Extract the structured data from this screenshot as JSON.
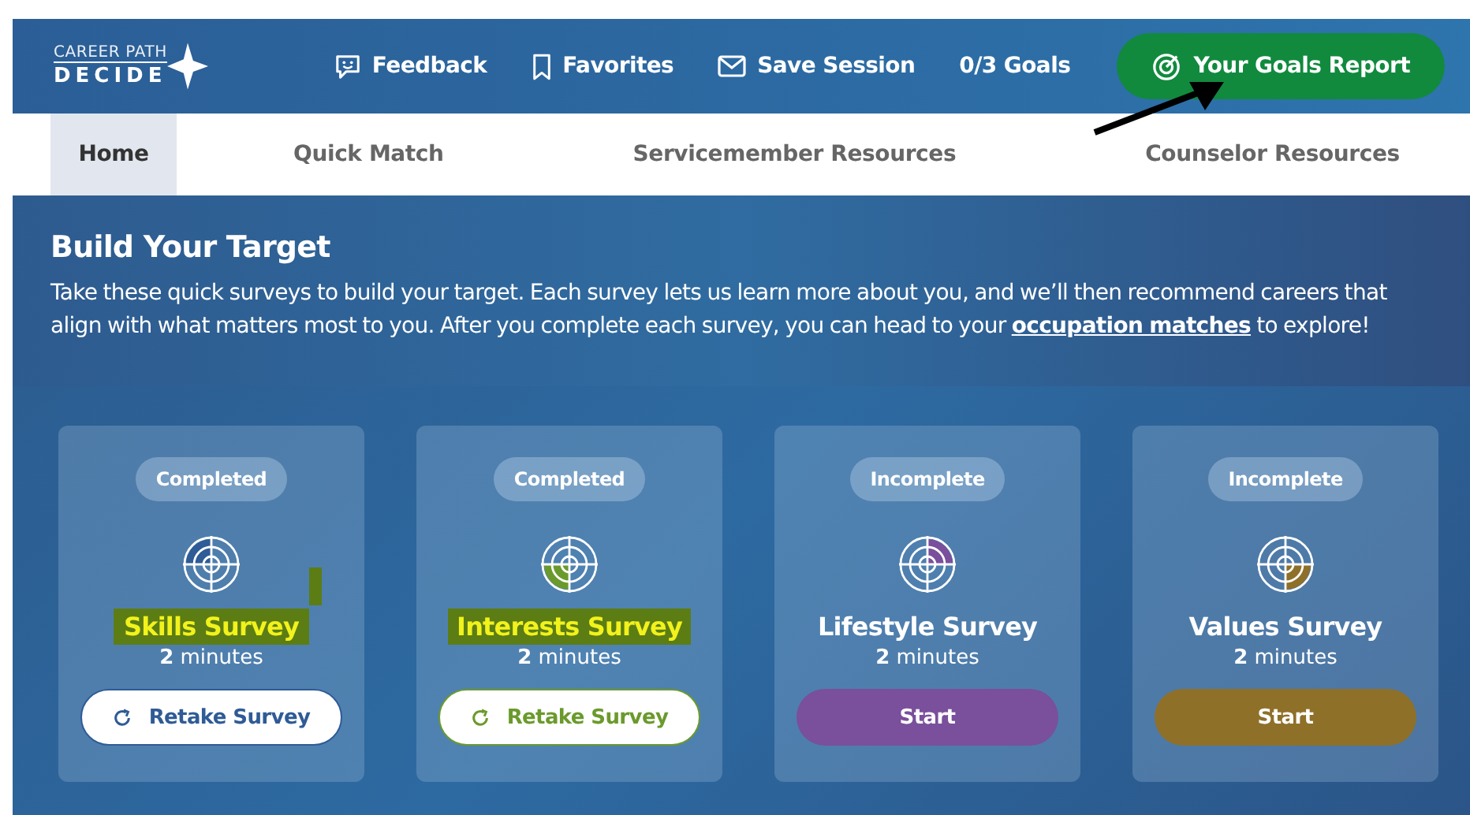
{
  "header": {
    "logo": {
      "top": "CAREER PATH",
      "bottom": "DECIDE"
    },
    "links": [
      {
        "kind": "feedback",
        "label": "Feedback"
      },
      {
        "kind": "favorites",
        "label": "Favorites"
      },
      {
        "kind": "save",
        "label": "Save Session"
      },
      {
        "kind": "goals",
        "label": "0/3 Goals"
      }
    ],
    "report_button": "Your Goals Report"
  },
  "tabs": [
    {
      "label": "Home",
      "selected": true
    },
    {
      "label": "Quick Match",
      "selected": false
    },
    {
      "label": "Servicemember Resources",
      "selected": false
    },
    {
      "label": "Counselor Resources",
      "selected": false
    }
  ],
  "intro": {
    "title": "Build Your Target",
    "text": "Take these quick surveys to build your target. Each survey lets us learn more about you, and we’ll then recommend careers that align with what matters most to you. After you complete each survey, you can head to your",
    "link": "occupation matches",
    "tail": "to explore!"
  },
  "cards": [
    {
      "kind": "completed",
      "status": "Completed",
      "fill_top": true,
      "fill_left": true,
      "color": "#2f5b96",
      "title": "Skills Survey",
      "highlighted": true,
      "duration_num": "2",
      "duration_unit": "minutes",
      "button": "Retake Survey"
    },
    {
      "kind": "completed",
      "status": "Completed",
      "fill_top": false,
      "fill_left": true,
      "color": "#6b9a2c",
      "title": "Interests Survey",
      "highlighted": true,
      "duration_num": "2",
      "duration_unit": "minutes",
      "button": "Retake Survey"
    },
    {
      "kind": "incomplete",
      "status": "Incomplete",
      "fill_top": true,
      "fill_left": false,
      "color": "#7a4f9b",
      "title": "Lifestyle Survey",
      "highlighted": false,
      "duration_num": "2",
      "duration_unit": "minutes",
      "button": "Start"
    },
    {
      "kind": "incomplete",
      "status": "Incomplete",
      "fill_top": false,
      "fill_left": false,
      "color": "#8f7029",
      "title": "Values Survey",
      "highlighted": false,
      "duration_num": "2",
      "duration_unit": "minutes",
      "button": "Start"
    }
  ]
}
